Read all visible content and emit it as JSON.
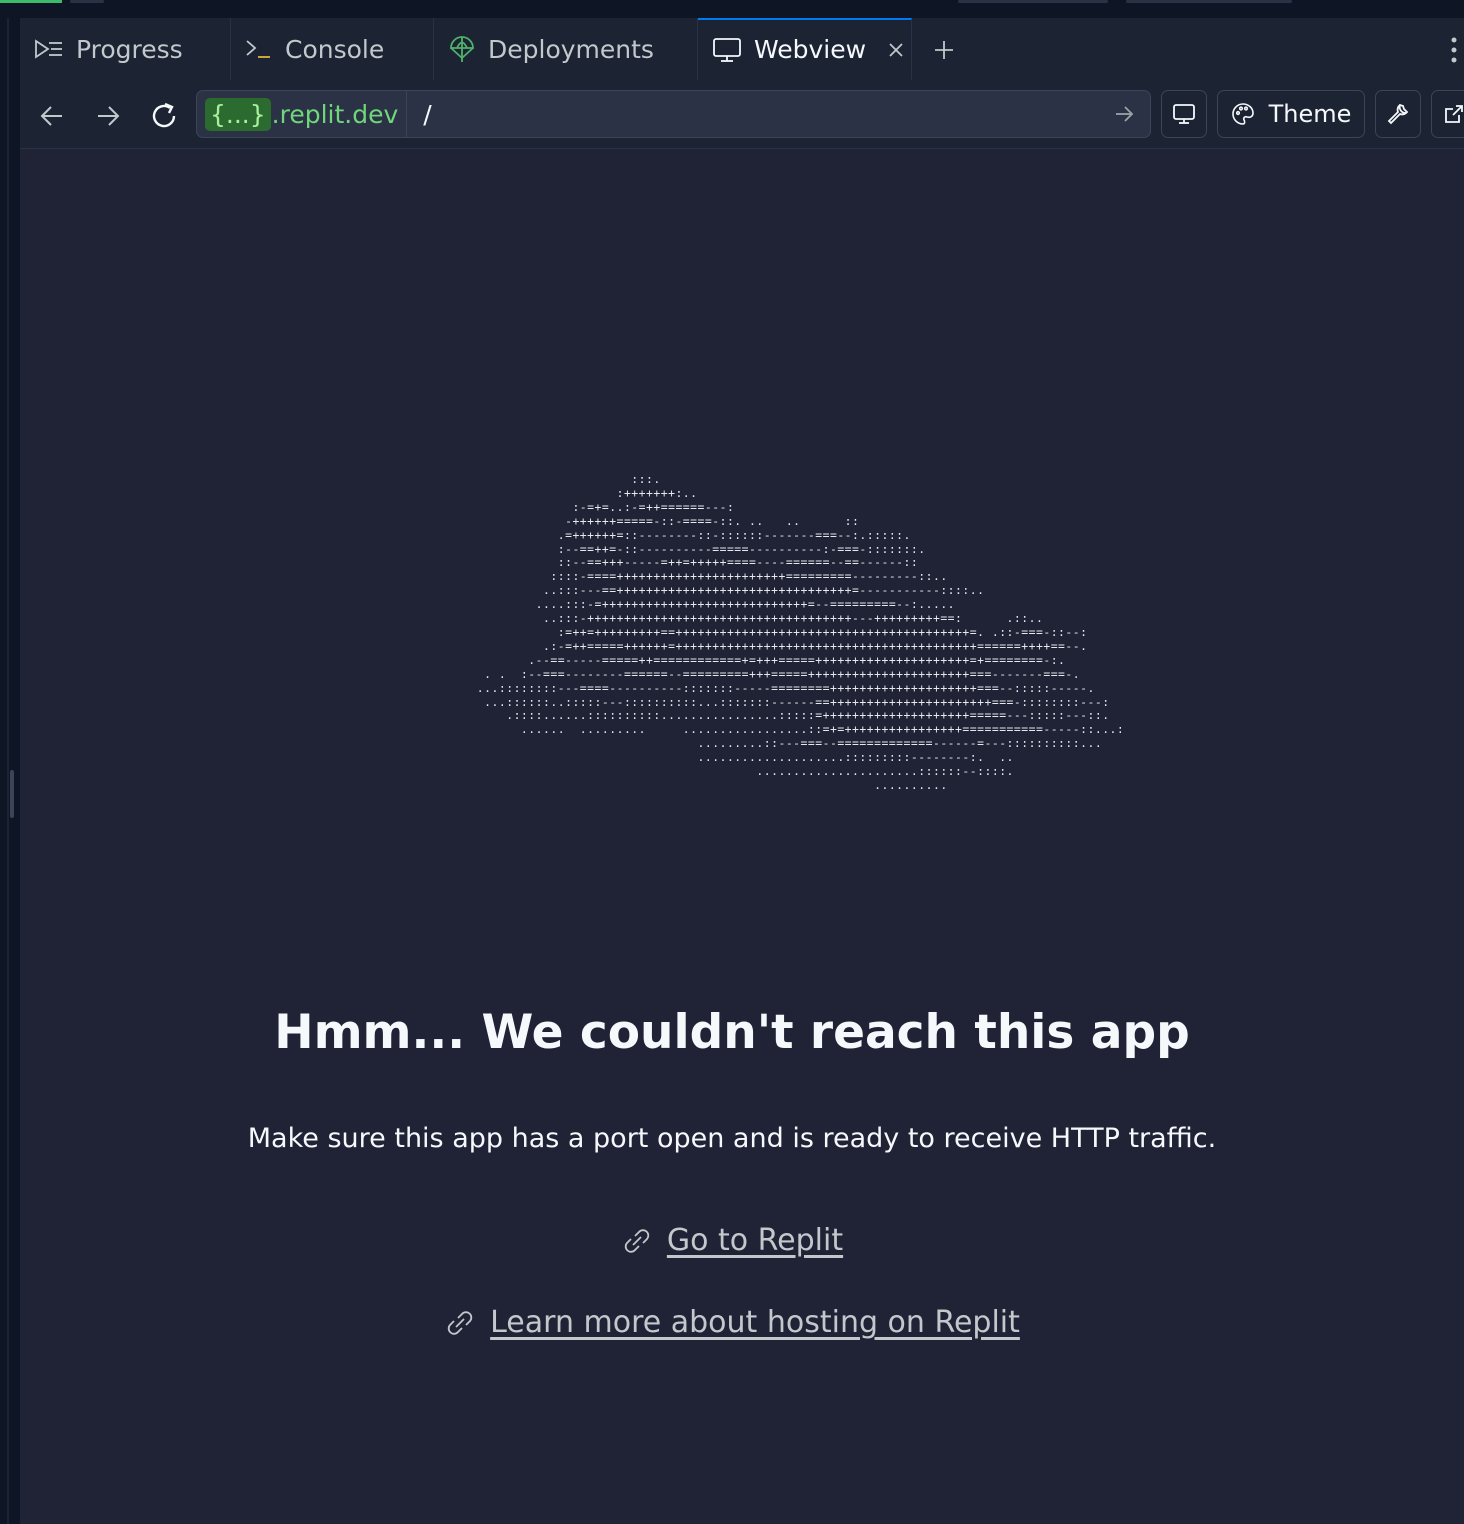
{
  "tabs": [
    {
      "label": "Progress",
      "icon": "progress-icon"
    },
    {
      "label": "Console",
      "icon": "console-icon"
    },
    {
      "label": "Deployments",
      "icon": "deployments-icon"
    },
    {
      "label": "Webview",
      "icon": "monitor-icon",
      "active": true,
      "closable": true
    }
  ],
  "toolbar": {
    "url_host_placeholder": "{...}",
    "url_host_domain": ".replit.dev",
    "url_path": "/",
    "theme_label": "Theme"
  },
  "error": {
    "ascii_art": "                          :::.\n                        :+++++++:..\n                  :-=+=..:-=++======---:\n                 -++++++=====-::-====-::. ..   ..      ::\n                .=++++++=::--------::-::::::-------===--:.:::::.\n                :--==++=-::----------=====----------:-===-:::::::.\n                ::--==+++-----=++=+++++====----======--==------::\n               ::::-====+++++++++++++++++++++++=========---------::..\n              ..:::---==++++++++++++++++++++++++++++++++=-----------::::..\n             ....:::-=++++++++++++++++++++++++++++=--=========--:.....\n              ..:::-++++++++++++++++++++++++++++++++++++---+++++++++==:      .::..\n                :=++=+++++++++==++++++++++++++++++++++++++++++++++++++++=. .::-===-::--:\n              .:-=++=====++++++=+++++++++++++++++++++++++++++++++++++++++======++++==--.\n            .--==-----=====++============+=+++=====+++++++++++++++++++++=+========-:.\n      . .  :--===--------======--=========+++=====++++++++++++++++++++++===-------===-.\n     ...::::::::---====----------:::::::-----========++++++++++++++++++++===--:::::-----.\n      ...::::::..:::::---::::::::::...:::::::------==++++++++++++++++++++++===-::::::::---:\n         .::::......::::::::::................:::::=++++++++++++++++++++=====---:::::---::.\n           ......  .........     .................::=+=++++++++++++++++===========-----::...:\n                                   .........::---===--=============------=---::::::::::...\n                                   ....................:::::::::--------:.  ..\n                                           ......................::::::--::::.\n                                                           ..........",
    "title": "Hmm... We couldn't reach this app",
    "message": "Make sure this app has a port open and is ready to receive HTTP traffic.",
    "links": [
      {
        "label": "Go to Replit",
        "icon": "link-icon"
      },
      {
        "label": "Learn more about hosting on Replit",
        "icon": "link-icon"
      }
    ]
  },
  "colors": {
    "background": "#1f2335",
    "chrome": "#1c2333",
    "accent": "#0079f2",
    "url_host": "#6fd67a"
  }
}
